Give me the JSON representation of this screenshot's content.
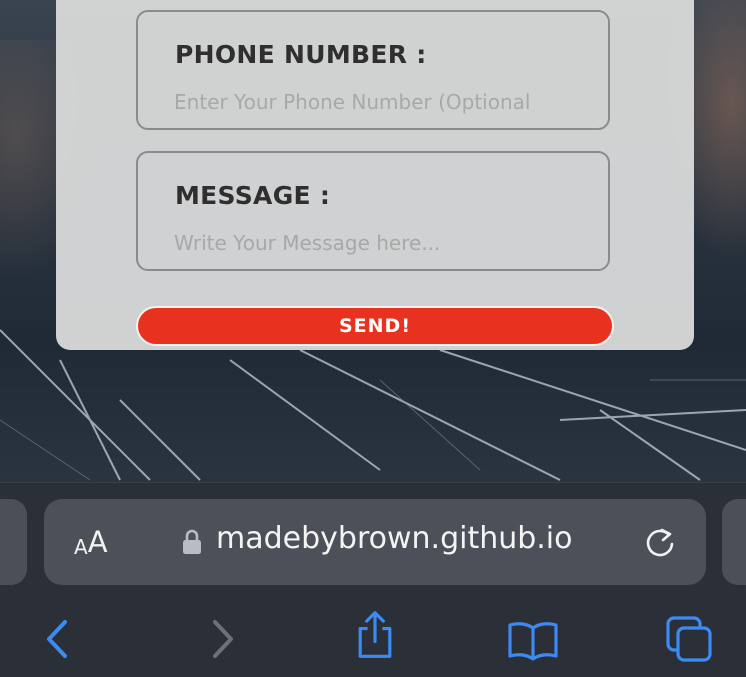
{
  "form": {
    "phone_label": "PHONE NUMBER :",
    "phone_placeholder": "Enter Your Phone Number (Optional",
    "phone_value": "",
    "message_label": "MESSAGE :",
    "message_placeholder": "Write Your Message here...",
    "message_value": "",
    "send_label": "SEND!",
    "accent_color": "#e8321f"
  },
  "browser": {
    "text_size_small": "A",
    "text_size_large": "A",
    "url": "madebybrown.github.io",
    "icons": {
      "lock": "lock-icon",
      "reload": "reload-icon",
      "back": "chevron-left-icon",
      "forward": "chevron-right-icon",
      "share": "share-icon",
      "bookmarks": "book-icon",
      "tabs": "tabs-icon"
    },
    "toolbar_icon_color": "#3d8bf2",
    "disabled_icon_color": "#6b7079"
  }
}
